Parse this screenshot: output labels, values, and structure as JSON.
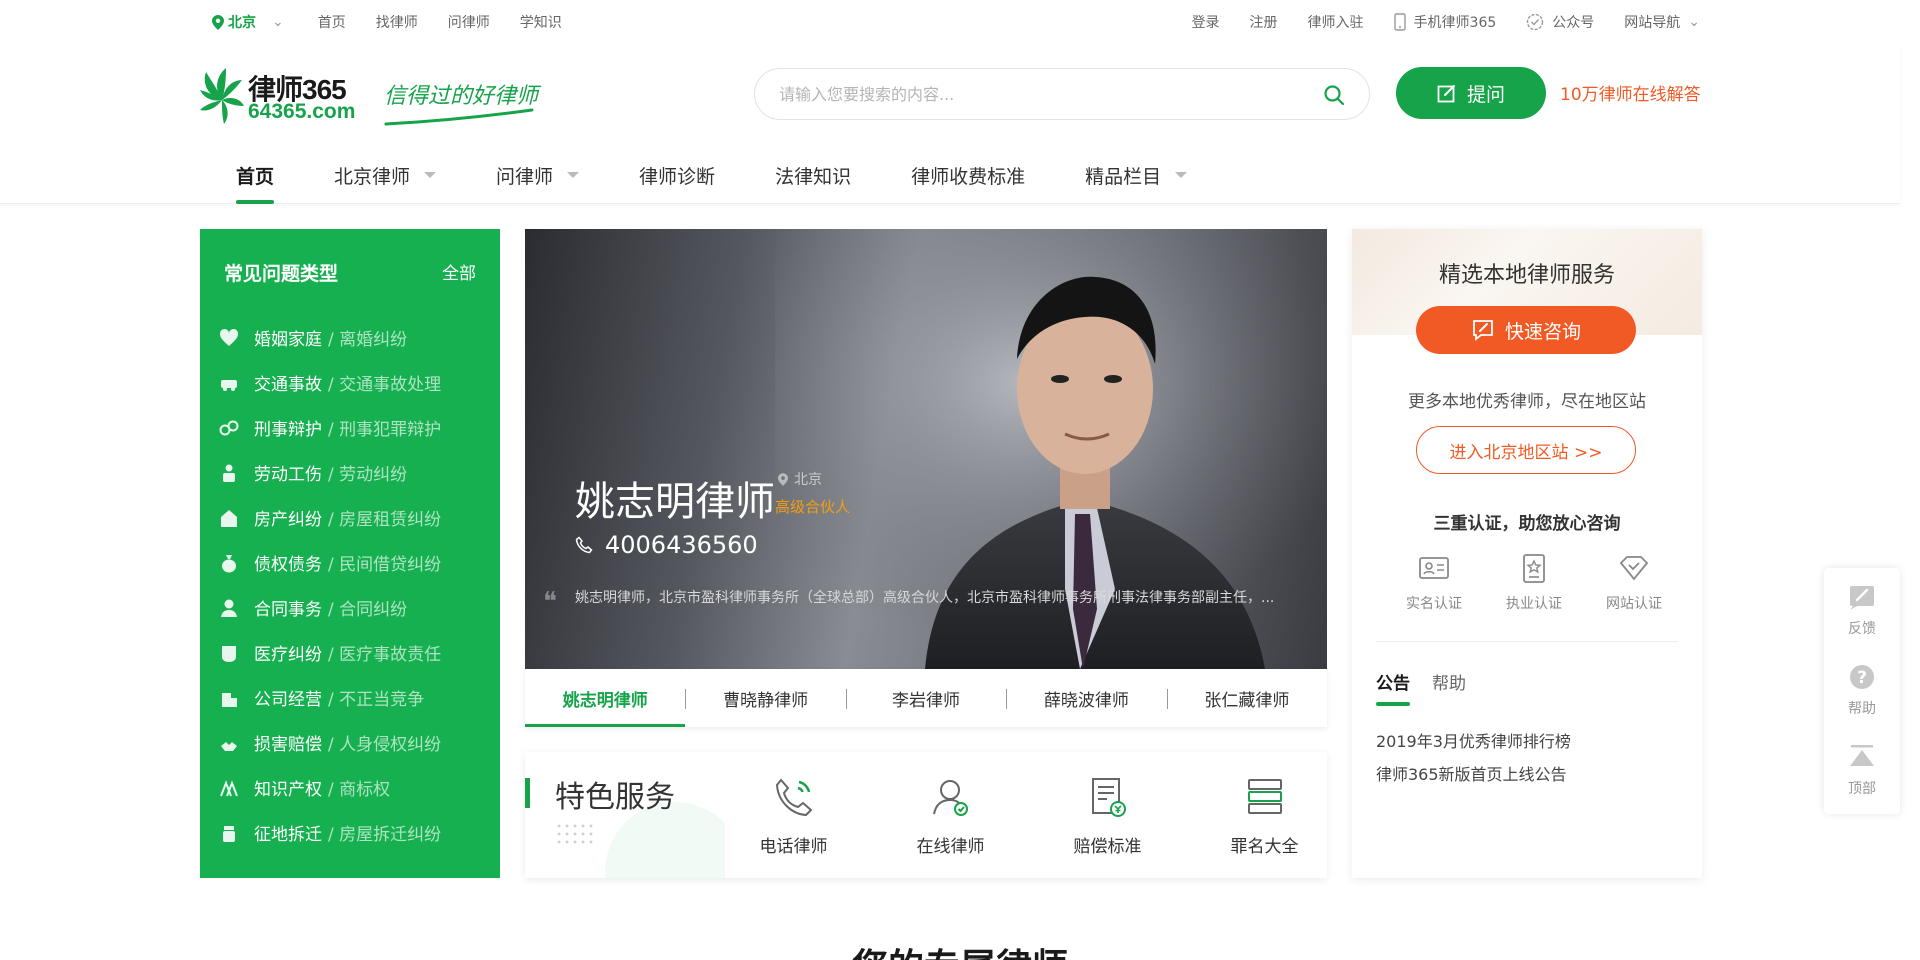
{
  "topbar": {
    "city": "北京",
    "links": [
      "首页",
      "找律师",
      "问律师",
      "学知识"
    ],
    "right": {
      "login": "登录",
      "register": "注册",
      "join": "律师入驻",
      "mobile": "手机律师365",
      "wechat": "公众号",
      "sitenav": "网站导航"
    }
  },
  "logo": {
    "brand": "律师365",
    "domain": "64365.com",
    "slogan": "信得过的好律师"
  },
  "search": {
    "placeholder": "请输入您要搜索的内容..."
  },
  "ask": {
    "label": "提问",
    "note": "10万律师在线解答"
  },
  "nav": {
    "home": "首页",
    "beijing": "北京律师",
    "ask": "问律师",
    "diagnose": "律师诊断",
    "knowledge": "法律知识",
    "fees": "律师收费标准",
    "featured": "精品栏目"
  },
  "categories": {
    "title": "常见问题类型",
    "all": "全部",
    "items": [
      {
        "main": "婚姻家庭",
        "sub": "/ 离婚纠纷",
        "icon": "heart-icon"
      },
      {
        "main": "交通事故",
        "sub": "/ 交通事故处理",
        "icon": "car-icon"
      },
      {
        "main": "刑事辩护",
        "sub": "/ 刑事犯罪辩护",
        "icon": "handcuffs-icon"
      },
      {
        "main": "劳动工伤",
        "sub": "/ 劳动纠纷",
        "icon": "worker-icon"
      },
      {
        "main": "房产纠纷",
        "sub": "/ 房屋租赁纠纷",
        "icon": "house-icon"
      },
      {
        "main": "债权债务",
        "sub": "/ 民间借贷纠纷",
        "icon": "money-bag-icon"
      },
      {
        "main": "合同事务",
        "sub": "/ 合同纠纷",
        "icon": "person-icon"
      },
      {
        "main": "医疗纠纷",
        "sub": "/ 医疗事故责任",
        "icon": "medical-icon"
      },
      {
        "main": "公司经营",
        "sub": "/ 不正当竞争",
        "icon": "building-icon"
      },
      {
        "main": "损害赔偿",
        "sub": "/ 人身侵权纠纷",
        "icon": "hands-icon"
      },
      {
        "main": "知识产权",
        "sub": "/ 商标权",
        "icon": "ip-icon"
      },
      {
        "main": "征地拆迁",
        "sub": "/ 房屋拆迁纠纷",
        "icon": "demolition-icon"
      }
    ]
  },
  "hero": {
    "name": "姚志明律师",
    "location": "北京",
    "title": "高级合伙人",
    "phone": "4006436560",
    "desc": "姚志明律师，北京市盈科律师事务所（全球总部）高级合伙人，北京市盈科律师事务所刑事法律事务部副主任，..."
  },
  "lawyerTabs": [
    "姚志明律师",
    "曹晓静律师",
    "李岩律师",
    "薛晓波律师",
    "张仁藏律师"
  ],
  "features": {
    "title": "特色服务",
    "items": [
      {
        "label": "电话律师",
        "icon": "phone-icon"
      },
      {
        "label": "在线律师",
        "icon": "online-lawyer-icon"
      },
      {
        "label": "赔偿标准",
        "icon": "compensation-doc-icon"
      },
      {
        "label": "罪名大全",
        "icon": "books-icon"
      }
    ]
  },
  "rpanel": {
    "title": "精选本地律师服务",
    "consult": "快速咨询",
    "more": "更多本地优秀律师，尽在地区站",
    "enter": "进入北京地区站 >>",
    "triple": "三重认证，助您放心咨询",
    "certs": [
      "实名认证",
      "执业认证",
      "网站认证"
    ],
    "tabs": [
      "公告",
      "帮助"
    ],
    "notices": [
      "2019年3月优秀律师排行榜",
      "律师365新版首页上线公告"
    ]
  },
  "floattools": [
    "反馈",
    "帮助",
    "顶部"
  ],
  "section": {
    "peek": "您的专属律师"
  },
  "colors": {
    "brand": "#16a34a",
    "accent": "#f15a24",
    "panel": "#16b050"
  }
}
